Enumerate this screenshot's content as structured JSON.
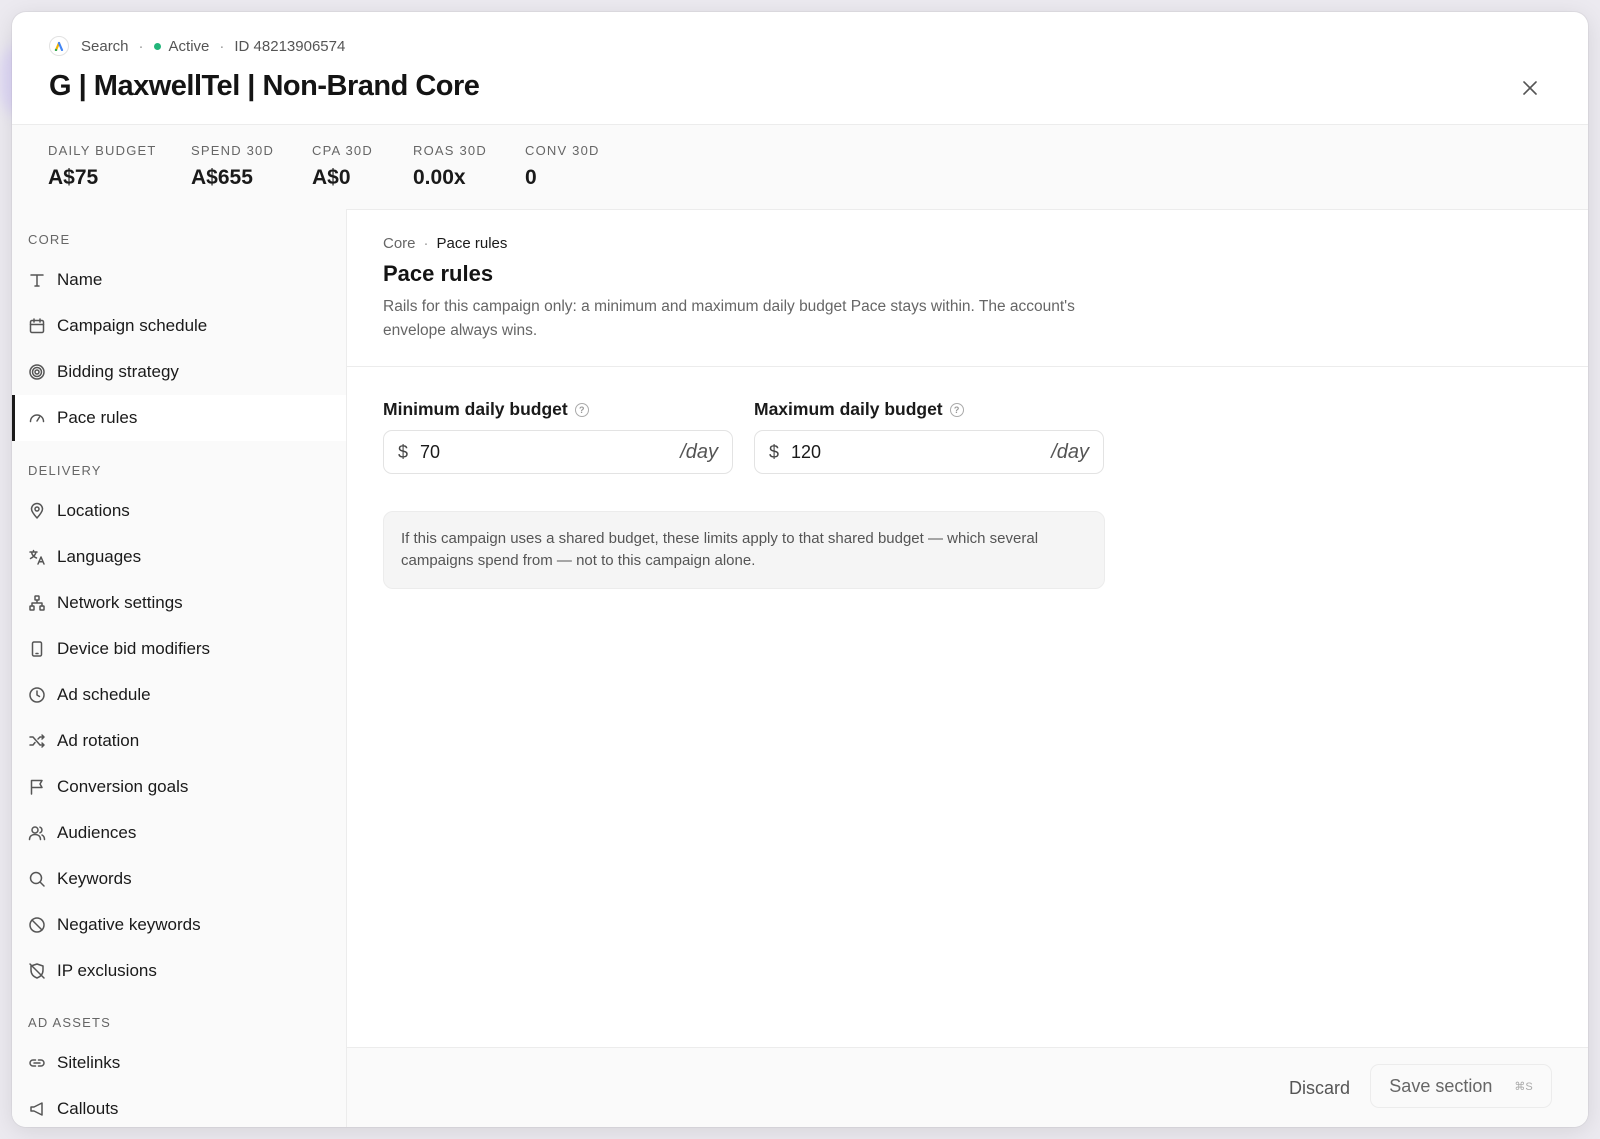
{
  "header": {
    "type_label": "Search",
    "status_label": "Active",
    "id_label": "ID 48213906574",
    "title": "G | MaxwellTel | Non-Brand Core",
    "close_icon": "close-icon",
    "status_color": "#22b57a"
  },
  "stats": [
    {
      "label": "DAILY BUDGET",
      "value": "A$75"
    },
    {
      "label": "SPEND 30D",
      "value": "A$655"
    },
    {
      "label": "CPA 30D",
      "value": "A$0"
    },
    {
      "label": "ROAS 30D",
      "value": "0.00x"
    },
    {
      "label": "CONV 30D",
      "value": "0"
    }
  ],
  "sidebar": {
    "sections": [
      {
        "label": "CORE",
        "items": [
          {
            "label": "Name",
            "icon": "text-icon"
          },
          {
            "label": "Campaign schedule",
            "icon": "calendar-icon"
          },
          {
            "label": "Bidding strategy",
            "icon": "target-icon"
          },
          {
            "label": "Pace rules",
            "icon": "gauge-icon",
            "active": true
          }
        ]
      },
      {
        "label": "DELIVERY",
        "items": [
          {
            "label": "Locations",
            "icon": "map-pin-icon"
          },
          {
            "label": "Languages",
            "icon": "translate-icon"
          },
          {
            "label": "Network settings",
            "icon": "network-icon"
          },
          {
            "label": "Device bid modifiers",
            "icon": "phone-icon"
          },
          {
            "label": "Ad schedule",
            "icon": "clock-icon"
          },
          {
            "label": "Ad rotation",
            "icon": "shuffle-icon"
          },
          {
            "label": "Conversion goals",
            "icon": "flag-icon"
          },
          {
            "label": "Audiences",
            "icon": "users-icon"
          },
          {
            "label": "Keywords",
            "icon": "search-icon"
          },
          {
            "label": "Negative keywords",
            "icon": "ban-icon"
          },
          {
            "label": "IP exclusions",
            "icon": "shield-off-icon"
          }
        ]
      },
      {
        "label": "AD ASSETS",
        "items": [
          {
            "label": "Sitelinks",
            "icon": "link-icon"
          },
          {
            "label": "Callouts",
            "icon": "megaphone-icon"
          }
        ]
      }
    ]
  },
  "main": {
    "breadcrumb": {
      "parent": "Core",
      "current": "Pace rules"
    },
    "title": "Pace rules",
    "description": "Rails for this campaign only: a minimum and maximum daily budget Pace stays within. The account's envelope always wins.",
    "min_field": {
      "label": "Minimum daily budget",
      "currency": "$",
      "value": "70",
      "unit": "/day"
    },
    "max_field": {
      "label": "Maximum daily budget",
      "currency": "$",
      "value": "120",
      "unit": "/day"
    },
    "note": "If this campaign uses a shared budget, these limits apply to that shared budget — which several campaigns spend from — not to this campaign alone."
  },
  "footer": {
    "discard_label": "Discard",
    "save_label": "Save section",
    "save_shortcut": "⌘S"
  }
}
